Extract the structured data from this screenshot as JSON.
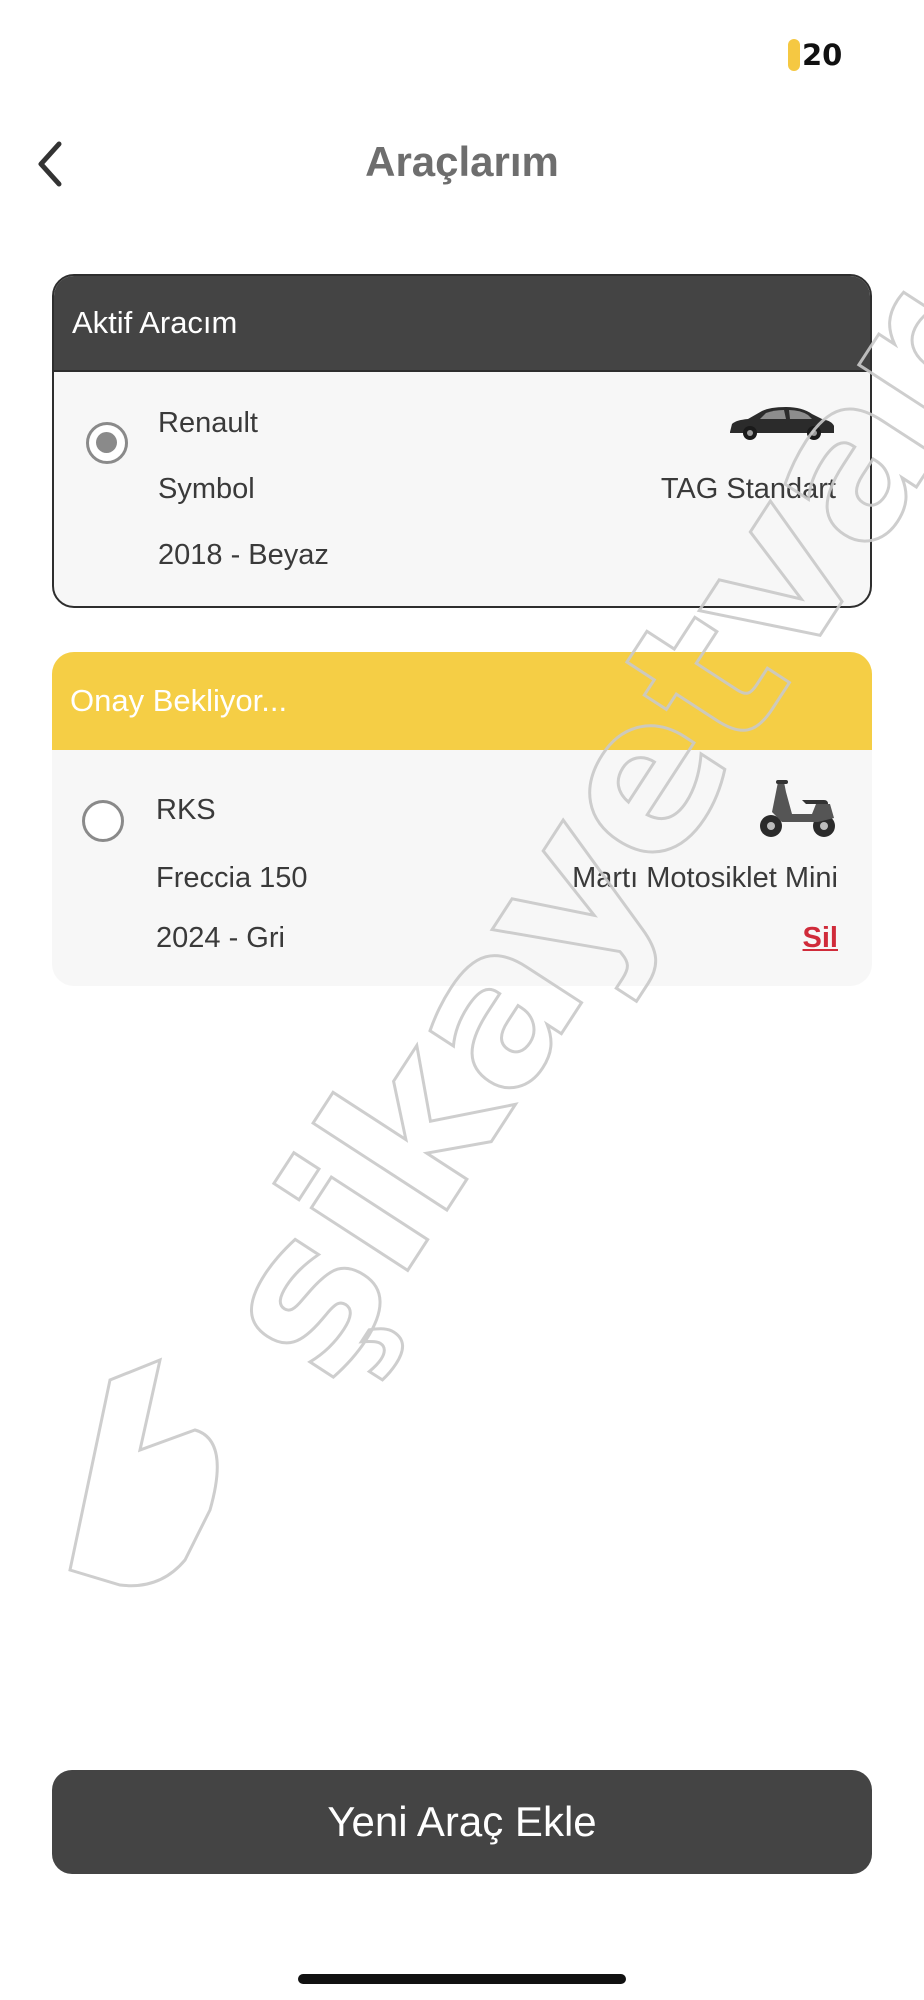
{
  "status": {
    "battery": "20"
  },
  "nav": {
    "title": "Araçlarım"
  },
  "active_card": {
    "header": "Aktif Aracım",
    "brand": "Renault",
    "model": "Symbol",
    "year_color": "2018 - Beyaz",
    "plan": "TAG Standart",
    "icon": "car-icon",
    "selected": true
  },
  "pending_card": {
    "header": "Onay Bekliyor...",
    "brand": "RKS",
    "model": "Freccia 150",
    "year_color": "2024 - Gri",
    "plan": "Martı Motosiklet Mini",
    "delete_label": "Sil",
    "icon": "scooter-icon",
    "selected": false
  },
  "add_button": {
    "label": "Yeni Araç Ekle"
  },
  "watermark": {
    "text": "şikayetvar"
  },
  "colors": {
    "dark": "#444444",
    "accent_yellow": "#f5ce45",
    "delete_red": "#d02b3a",
    "title_gray": "#6e6e6e"
  }
}
